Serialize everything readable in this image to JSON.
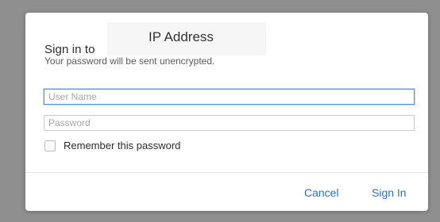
{
  "dialog": {
    "title": "Sign in to",
    "host": "IP Address",
    "subtitle": "Your password will be sent unencrypted.",
    "username_placeholder": "User Name",
    "password_placeholder": "Password",
    "remember_label": "Remember this password",
    "cancel_label": "Cancel",
    "signin_label": "Sign In"
  },
  "colors": {
    "accent": "#2f6fcf",
    "focus_ring": "#5b8fd6",
    "backdrop": "#8f8f8f"
  }
}
